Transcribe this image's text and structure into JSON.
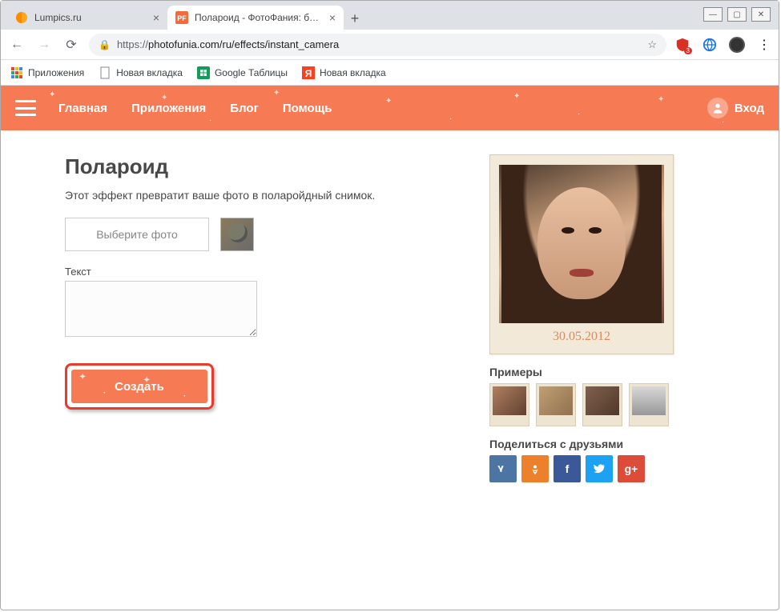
{
  "window": {
    "tabs": [
      {
        "title": "Lumpics.ru"
      },
      {
        "title": "Полароид - ФотоФания: беспла"
      }
    ],
    "url_proto": "https://",
    "url_rest": "photofunia.com/ru/effects/instant_camera",
    "ublock_badge": "3"
  },
  "bookmarks": {
    "apps": "Приложения",
    "items": [
      {
        "label": "Новая вкладка"
      },
      {
        "label": "Google Таблицы"
      },
      {
        "label": "Новая вкладка"
      }
    ]
  },
  "nav": {
    "home": "Главная",
    "apps": "Приложения",
    "blog": "Блог",
    "help": "Помощь",
    "login": "Вход"
  },
  "main": {
    "title": "Полароид",
    "description": "Этот эффект превратит ваше фото в поларойдный снимок.",
    "choose_label": "Выберите фото",
    "text_label": "Текст",
    "go_label": "Создать"
  },
  "sidebar": {
    "preview_date": "30.05.2012",
    "examples_title": "Примеры",
    "share_title": "Поделиться с друзьями",
    "social": {
      "vk": "B",
      "ok": "O",
      "fb": "f",
      "tw": "t",
      "gp": "g+"
    }
  }
}
